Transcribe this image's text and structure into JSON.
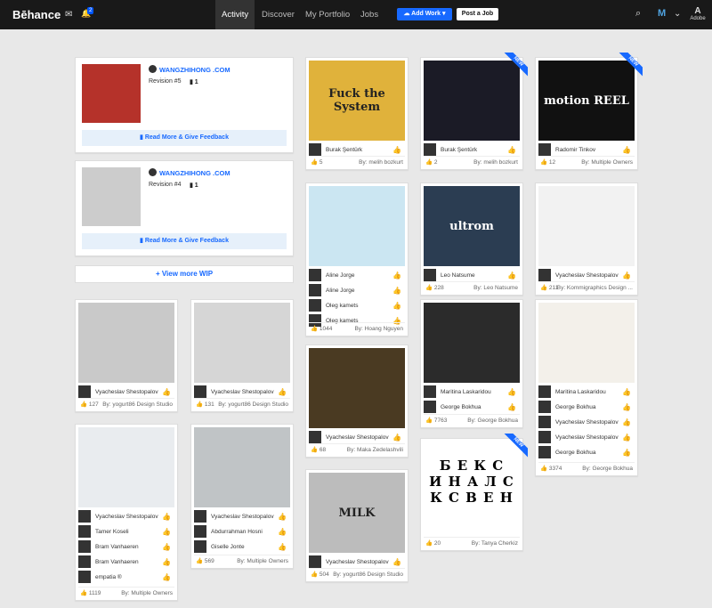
{
  "header": {
    "logo": "Bēhance",
    "notification_count": "2",
    "nav": [
      "Activity",
      "Discover",
      "My Portfolio",
      "Jobs"
    ],
    "add_work": "Add Work",
    "post_job": "Post a Job",
    "adobe": "Adobe"
  },
  "wip": [
    {
      "owner": "WANGZHIHONG .COM",
      "revision": "Revision #5",
      "comments": "1",
      "feedback": "Read More & Give Feedback"
    },
    {
      "owner": "WANGZHIHONG .COM",
      "revision": "Revision #4",
      "comments": "1",
      "feedback": "Read More & Give Feedback"
    }
  ],
  "view_more_wip": "+ View more WIP",
  "projects": [
    {
      "id": "p1",
      "owners": [
        "Vyacheslav Shestopalov"
      ],
      "appreciations": "127",
      "by": "By: yogurt86 Design Studio"
    },
    {
      "id": "p2",
      "owners": [
        "Vyacheslav Shestopalov"
      ],
      "appreciations": "131",
      "by": "By: yogurt86 Design Studio"
    },
    {
      "id": "p3",
      "owners": [
        "Vyacheslav Shestopalov",
        "Tamer Koseli",
        "Bram Vanhaeren",
        "Bram Vanhaeren",
        "empatia ®"
      ],
      "appreciations": "1119",
      "by": "By: Multiple Owners"
    },
    {
      "id": "p4",
      "owners": [
        "Vyacheslav Shestopalov",
        "Abdurrahman Hosni",
        "Giselle Jonte"
      ],
      "appreciations": "569",
      "by": "By: Multiple Owners"
    },
    {
      "id": "p5",
      "title_art": "Fuck the System",
      "owners": [
        "Burak Şentürk"
      ],
      "appreciations": "5",
      "by": "By: melih bozkurt"
    },
    {
      "id": "p6",
      "owners": [
        "Aline Jorge",
        "Aline Jorge",
        "Oleg kamets",
        "Oleg kamets"
      ],
      "appreciations": "1044",
      "by": "By: Hoang Nguyen"
    },
    {
      "id": "p7",
      "owners": [
        "Vyacheslav Shestopalov"
      ],
      "appreciations": "68",
      "by": "By: Maka Zedelashvili"
    },
    {
      "id": "p8",
      "art": "MILK",
      "owners": [
        "Vyacheslav Shestopalov"
      ],
      "appreciations": "504",
      "by": "By: yogurt86 Design Studio"
    },
    {
      "id": "p9",
      "new": "NEW",
      "owners": [
        "Burak Şentürk"
      ],
      "appreciations": "2",
      "by": "By: melih bozkurt"
    },
    {
      "id": "p10",
      "art": "ultrom",
      "owners": [
        "Leo Natsume"
      ],
      "appreciations": "228",
      "by": "By: Leo Natsume"
    },
    {
      "id": "p11",
      "owners": [
        "Maritina Laskaridou",
        "George Bokhua"
      ],
      "appreciations": "7763",
      "by": "By: George Bokhua"
    },
    {
      "id": "p12",
      "new": "NEW",
      "owners": [],
      "appreciations": "20",
      "by": "By: Tanya Cherkiz",
      "letters": [
        "Б Е К С",
        "И Н А Л С",
        "К С В Е Н"
      ]
    },
    {
      "id": "p13",
      "new": "NEW",
      "art": "motion REEL",
      "owners": [
        "Radomir Tinkov"
      ],
      "appreciations": "12",
      "by": "By: Multiple Owners"
    },
    {
      "id": "p14",
      "owners": [
        "Vyacheslav Shestopalov"
      ],
      "appreciations": "211",
      "by": "By: Kommigraphics Design ..."
    },
    {
      "id": "p15",
      "owners": [
        "Maritina Laskaridou",
        "George Bokhua",
        "Vyacheslav Shestopalov",
        "Vyacheslav Shestopalov",
        "George Bokhua"
      ],
      "appreciations": "3374",
      "by": "By: George Bokhua"
    }
  ],
  "colors": {
    "accent": "#1769ff",
    "topbar": "#191919"
  }
}
